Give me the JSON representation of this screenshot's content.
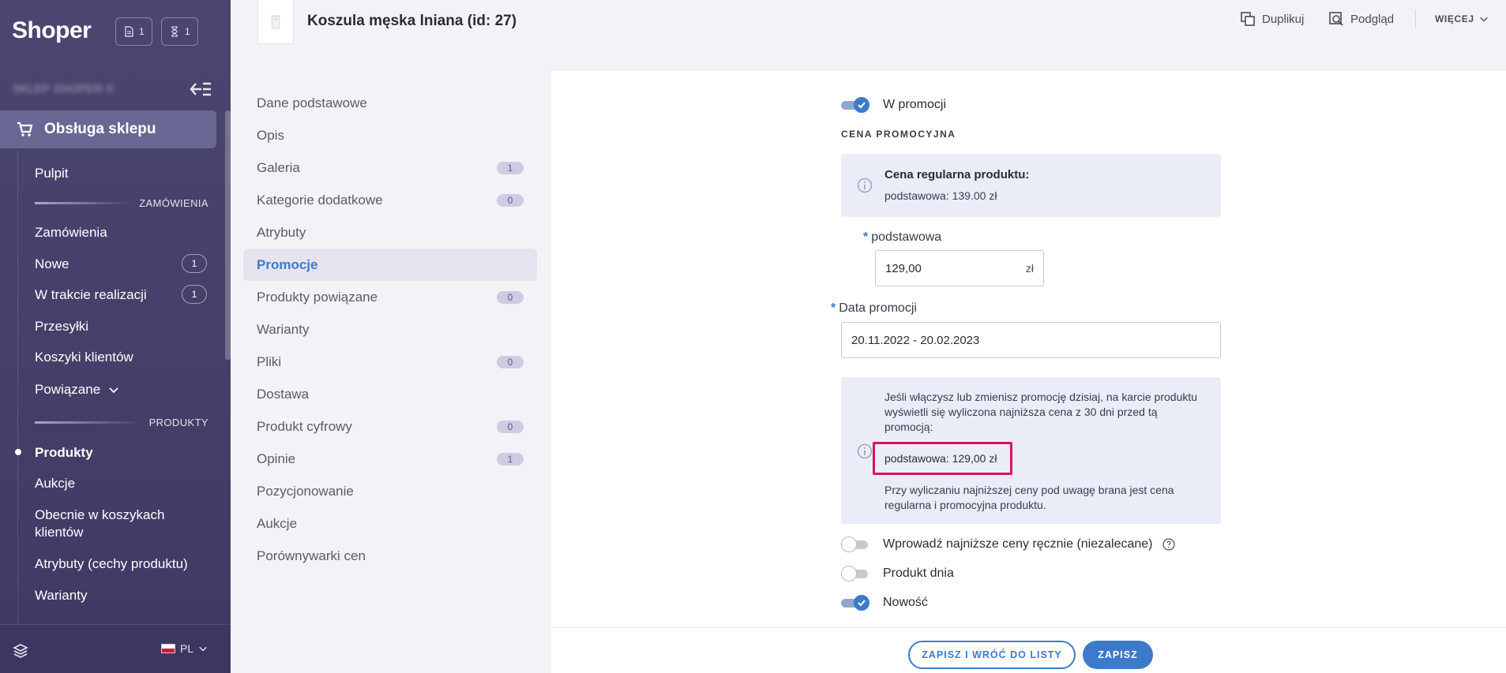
{
  "sidebar": {
    "logo": "Shoper",
    "badges": [
      {
        "icon": "document-icon",
        "count": "1"
      },
      {
        "icon": "hourglass-icon",
        "count": "1"
      }
    ],
    "shop_name": "SKLEP SHOPER S",
    "active_section": "Obsługa sklepu",
    "items": [
      {
        "label": "Pulpit"
      },
      {
        "section": "ZAMÓWIENIA"
      },
      {
        "label": "Zamówienia"
      },
      {
        "label": "Nowe",
        "count": "1"
      },
      {
        "label": "W trakcie realizacji",
        "count": "1"
      },
      {
        "label": "Przesyłki"
      },
      {
        "label": "Koszyki klientów"
      },
      {
        "label": "Powiązane"
      },
      {
        "section": "PRODUKTY"
      },
      {
        "label": "Produkty"
      },
      {
        "label": "Aukcje"
      },
      {
        "label": "Obecnie w koszykach klientów"
      },
      {
        "label": "Atrybuty (cechy produktu)"
      },
      {
        "label": "Warianty"
      }
    ],
    "language": "PL"
  },
  "header": {
    "title": "Koszula męska lniana (id: 27)",
    "duplicate": "Duplikuj",
    "preview": "Podgląd",
    "more": "WIĘCEJ"
  },
  "tabs": [
    {
      "label": "Dane podstawowe"
    },
    {
      "label": "Opis"
    },
    {
      "label": "Galeria",
      "count": "1"
    },
    {
      "label": "Kategorie dodatkowe",
      "count": "0"
    },
    {
      "label": "Atrybuty"
    },
    {
      "label": "Promocje",
      "active": true
    },
    {
      "label": "Produkty powiązane",
      "count": "0"
    },
    {
      "label": "Warianty"
    },
    {
      "label": "Pliki",
      "count": "0"
    },
    {
      "label": "Dostawa"
    },
    {
      "label": "Produkt cyfrowy",
      "count": "0"
    },
    {
      "label": "Opinie",
      "count": "1"
    },
    {
      "label": "Pozycjonowanie"
    },
    {
      "label": "Aukcje"
    },
    {
      "label": "Porównywarki cen"
    }
  ],
  "promo": {
    "in_promo_label": "W promocji",
    "section_heading": "CENA PROMOCYJNA",
    "regular_title": "Cena regularna produktu:",
    "regular_value": "podstawowa: 139.00 zł",
    "price_label": "podstawowa",
    "price_value": "129,00",
    "price_unit": "zł",
    "date_label": "Data promocji",
    "date_value": "20.11.2022 - 20.02.2023",
    "lowest_info": "Jeśli włączysz lub zmienisz promocję dzisiaj, na karcie produktu wyświetli się wyliczona najniższa cena z 30 dni przed tą promocją:",
    "lowest_value": "podstawowa: 129,00 zł",
    "lowest_note": "Przy wyliczaniu najniższej ceny pod uwagę brana jest cena regularna i promocyjna produktu.",
    "manual_label": "Wprowadź najniższe ceny ręcznie (niezalecane)",
    "product_of_day_label": "Produkt dnia",
    "new_label": "Nowość"
  },
  "footer": {
    "save_back": "ZAPISZ I WRÓĆ DO LISTY",
    "save": "ZAPISZ"
  },
  "colors": {
    "sidebar_bg": "#4a4670",
    "accent": "#3d7ac9",
    "highlight": "#d7145a",
    "info_bg": "#eaedf7"
  }
}
